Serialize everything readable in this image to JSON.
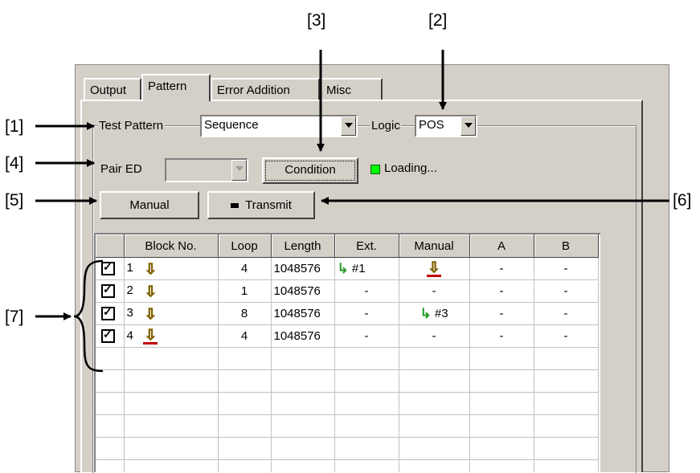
{
  "callouts": {
    "c1": "[1]",
    "c2": "[2]",
    "c3": "[3]",
    "c4": "[4]",
    "c5": "[5]",
    "c6": "[6]",
    "c7": "[7]"
  },
  "tabs": [
    "Output",
    "Pattern",
    "Error Addition",
    "Misc"
  ],
  "test_pattern": {
    "label": "Test Pattern",
    "value": "Sequence"
  },
  "logic": {
    "label": "Logic",
    "value": "POS"
  },
  "pair_ed": {
    "label": "Pair ED",
    "value": ""
  },
  "buttons": {
    "condition": "Condition",
    "manual": "Manual",
    "transmit": "Transmit"
  },
  "status": {
    "loading": "Loading..."
  },
  "table": {
    "headers": [
      "",
      "Block No.",
      "Loop",
      "Length",
      "Ext.",
      "Manual",
      "A",
      "B"
    ],
    "rows": [
      {
        "no": "1",
        "loop": "4",
        "length": "1048576",
        "ext": "#1",
        "manual": "",
        "a": "-",
        "b": "-"
      },
      {
        "no": "2",
        "loop": "1",
        "length": "1048576",
        "ext": "-",
        "manual": "-",
        "a": "-",
        "b": "-"
      },
      {
        "no": "3",
        "loop": "8",
        "length": "1048576",
        "ext": "-",
        "manual": "#3",
        "a": "-",
        "b": "-"
      },
      {
        "no": "4",
        "loop": "4",
        "length": "1048576",
        "ext": "-",
        "manual": "-",
        "a": "-",
        "b": "-"
      }
    ]
  }
}
